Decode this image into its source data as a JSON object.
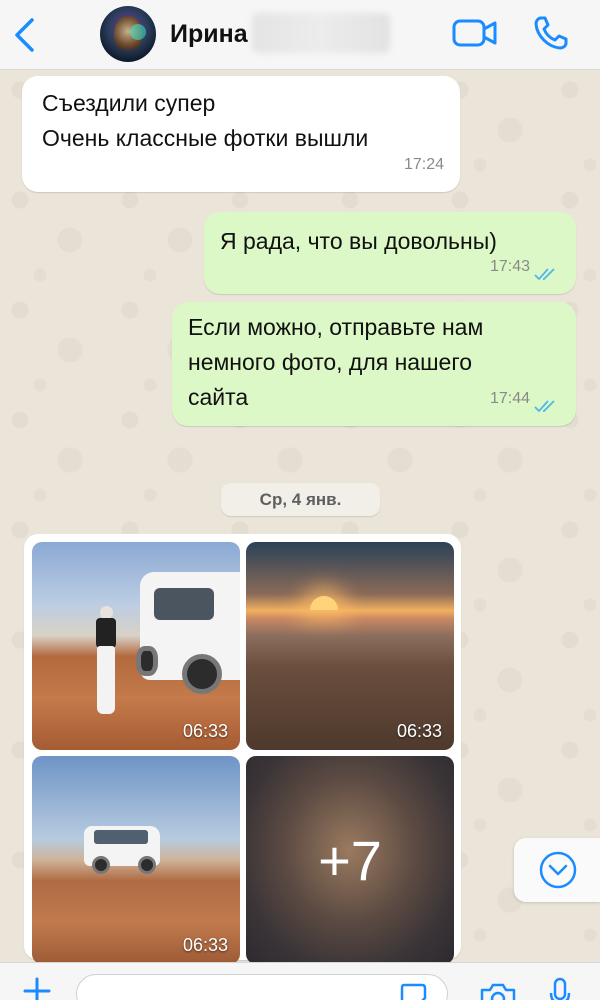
{
  "colors": {
    "accent": "#1a8cff",
    "outgoing_bubble": "#dcf8c6",
    "incoming_bubble": "#ffffff",
    "read_ticks": "#4fb6ec"
  },
  "header": {
    "contact_name": "Ирина",
    "icons": [
      "chevron-left-icon",
      "video-camera-icon",
      "phone-icon"
    ]
  },
  "messages": [
    {
      "direction": "incoming",
      "lines": [
        "Съездили супер",
        "Очень классные фотки вышли"
      ],
      "time": "17:24"
    },
    {
      "direction": "outgoing",
      "lines": [
        "Я рада, что вы довольны)"
      ],
      "time": "17:43",
      "status": "read"
    },
    {
      "direction": "outgoing",
      "lines": [
        "Если можно, отправьте нам",
        "немного фото, для нашего",
        "сайта"
      ],
      "time": "17:44",
      "status": "read"
    }
  ],
  "date_separator": "Ср, 4 янв.",
  "album": {
    "photos": [
      {
        "time": "06:33"
      },
      {
        "time": "06:33"
      },
      {
        "time": "06:33"
      }
    ],
    "more_count": "+7"
  },
  "input_bar": {
    "icons": [
      "plus-icon",
      "sticker-icon",
      "camera-icon",
      "microphone-icon"
    ]
  }
}
